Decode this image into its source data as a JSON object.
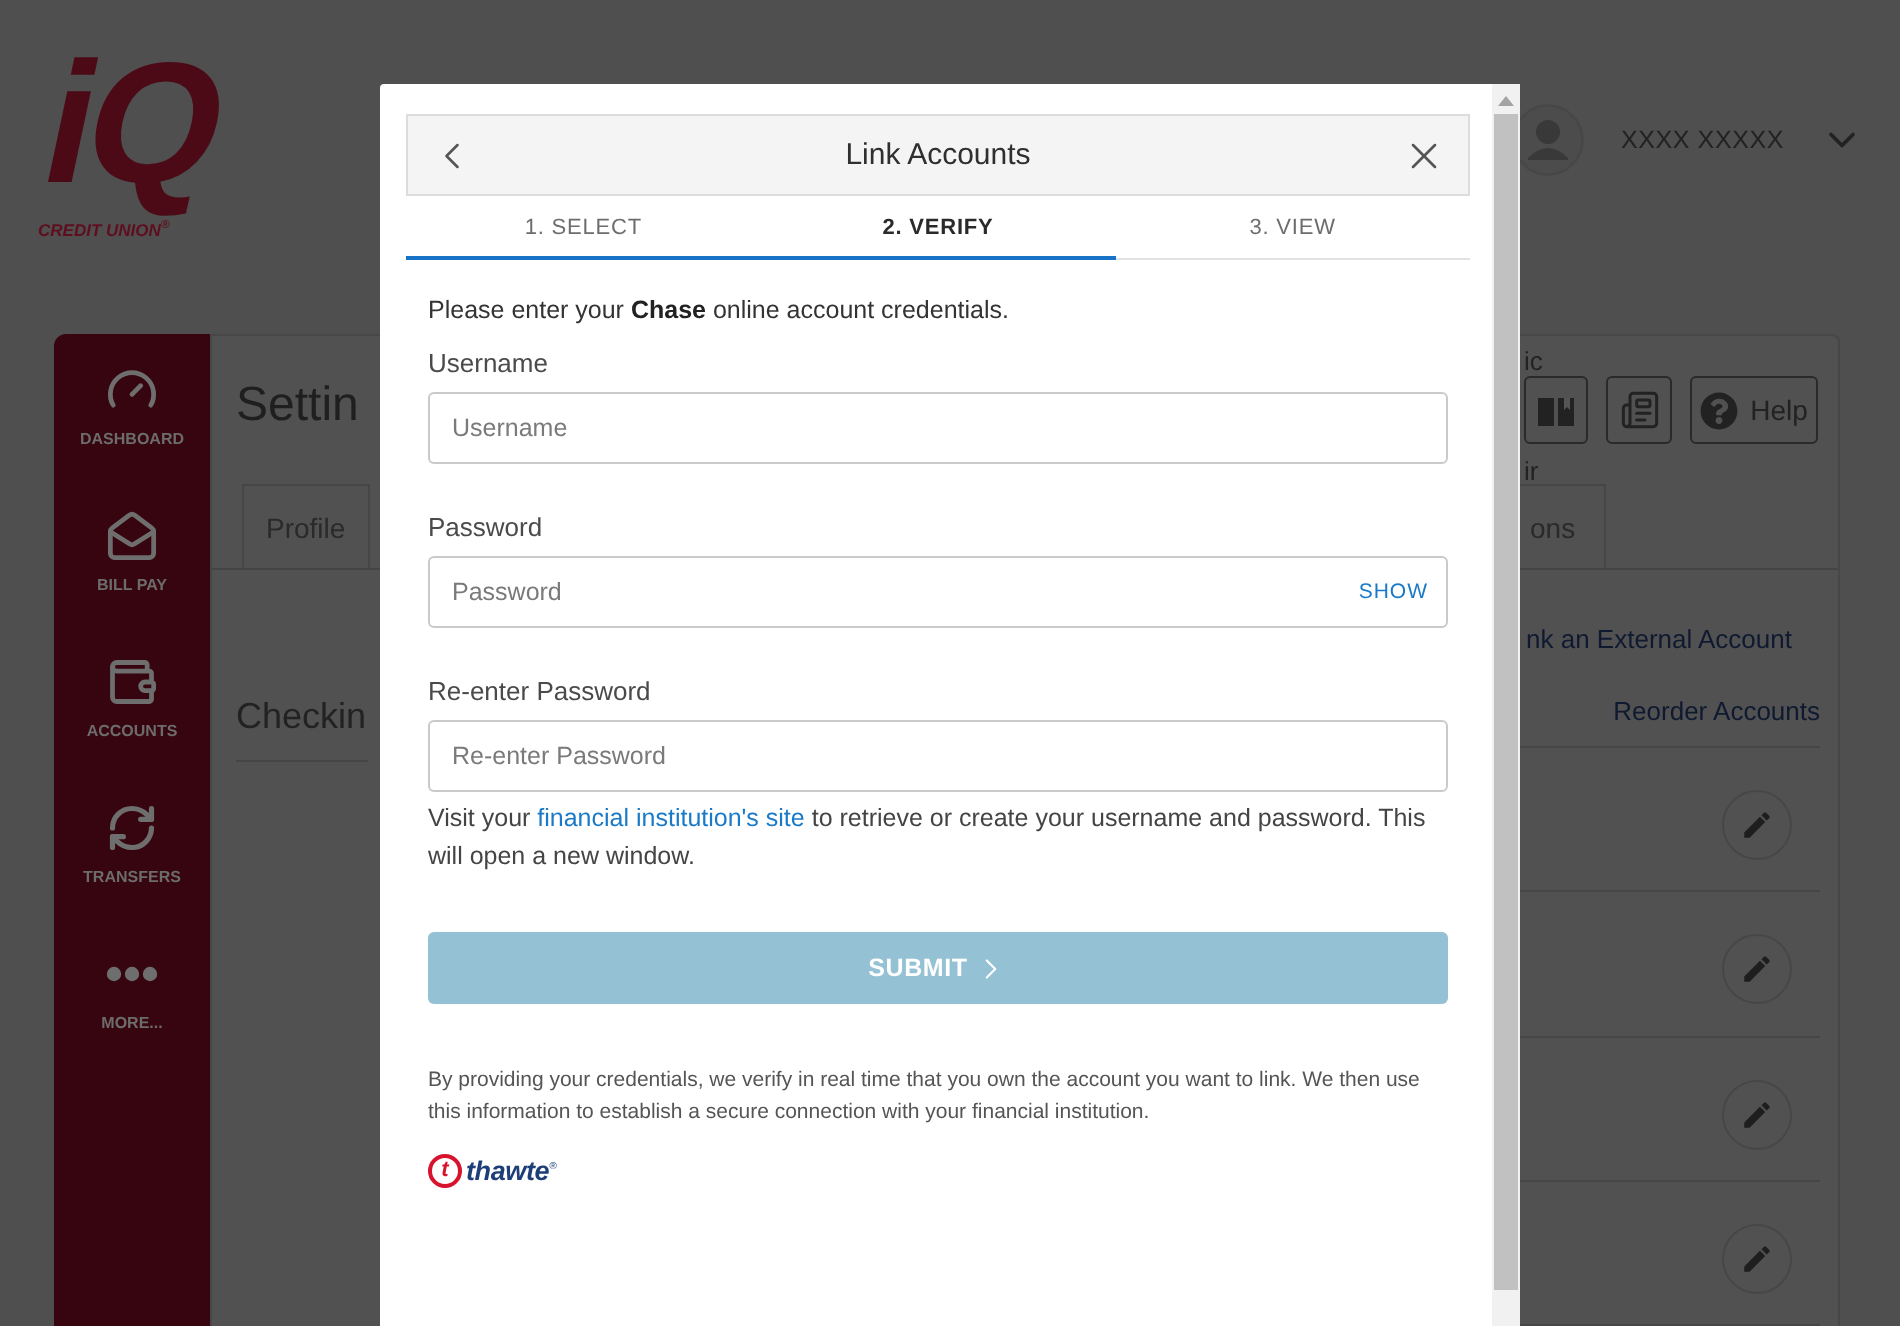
{
  "header": {
    "logo": {
      "mark": "iQ",
      "tagline": "CREDIT UNION$^{®}$"
    },
    "user": {
      "name": "XXXX XXXXX"
    }
  },
  "sidebar": {
    "items": [
      {
        "label": "DASHBOARD"
      },
      {
        "label": "BILL PAY"
      },
      {
        "label": "ACCOUNTS"
      },
      {
        "label": "TRANSFERS"
      },
      {
        "label": "MORE..."
      }
    ]
  },
  "page": {
    "title": "Settin",
    "tabs": [
      {
        "label": "Profile"
      },
      {
        "label": "ons"
      }
    ],
    "section_title": "Checkin",
    "fragments": [
      "ic",
      "ir"
    ],
    "help_button": "Help",
    "links": [
      "nk an External Account",
      "Reorder Accounts"
    ],
    "account_rows": [
      {
        "kind": "edit"
      },
      {
        "kind": "edit"
      },
      {
        "kind": "edit"
      },
      {
        "kind": "edit"
      }
    ]
  },
  "dialog": {
    "title": "Link Accounts",
    "steps": [
      {
        "label": "1. SELECT",
        "selected": false,
        "reached": true
      },
      {
        "label": "2. VERIFY",
        "selected": true,
        "reached": true
      },
      {
        "label": "3. VIEW",
        "selected": false,
        "reached": false
      }
    ],
    "intro": "Please enter your **Chase** online account credentials.",
    "fields": [
      {
        "label": "Username",
        "placeholder": "Username"
      },
      {
        "label": "Password",
        "placeholder": "Password",
        "toggle": "SHOW"
      },
      {
        "label": "Re-enter Password",
        "placeholder": "Re-enter Password"
      }
    ],
    "help": {
      "before": "Visit your ",
      "link": "financial institution's site",
      "after": " to retrieve or create your username and password. This will open a new window."
    },
    "submit": {
      "label": "SUBMIT",
      "disabled": true
    },
    "disclaimer": "By providing your credentials, we verify in real time that you own the account you want to link. We then use this information to establish a secure connection with your financial institution.",
    "seal": {
      "mark": "t",
      "name": "thawte$^{®}$"
    }
  }
}
